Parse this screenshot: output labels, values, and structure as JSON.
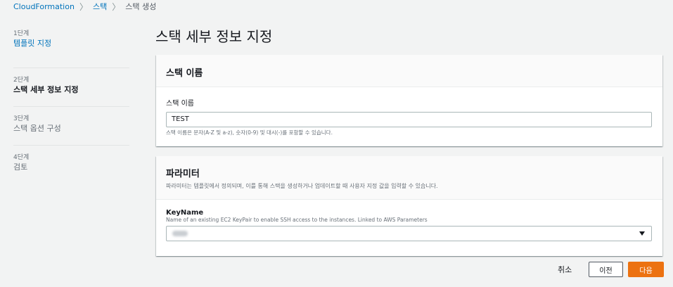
{
  "breadcrumb": {
    "items": [
      "CloudFormation",
      "스택",
      "스택 생성"
    ],
    "separator": "〉"
  },
  "steps": [
    {
      "number": "1단계",
      "label": "템플릿 지정",
      "state": "link"
    },
    {
      "number": "2단계",
      "label": "스택 세부 정보 지정",
      "state": "active"
    },
    {
      "number": "3단계",
      "label": "스택 옵션 구성",
      "state": "muted"
    },
    {
      "number": "4단계",
      "label": "검토",
      "state": "muted"
    }
  ],
  "page": {
    "title": "스택 세부 정보 지정"
  },
  "stack_name_panel": {
    "title": "스택 이름",
    "field_label": "스택 이름",
    "field_value": "TEST",
    "field_help": "스택 이름은 문자(A-Z 및 a-z), 숫자(0-9) 및 대시(-)를 포함할 수 있습니다."
  },
  "parameters_panel": {
    "title": "파라미터",
    "description": "파라미터는 템플릿에서 정의되며, 이를 통해 스택을 생성하거나 업데이트할 때 사용자 지정 값을 입력할 수 있습니다.",
    "keyname": {
      "label": "KeyName",
      "description": "Name of an existing EC2 KeyPair to enable SSH access to the instances. Linked to AWS Parameters",
      "selected_value": ""
    }
  },
  "footer": {
    "cancel": "취소",
    "previous": "이전",
    "next": "다음"
  },
  "colors": {
    "link": "#0073bb",
    "primary": "#ec7211",
    "background": "#f2f3f3"
  },
  "icons": {
    "select_caret": "caret-down-icon"
  }
}
